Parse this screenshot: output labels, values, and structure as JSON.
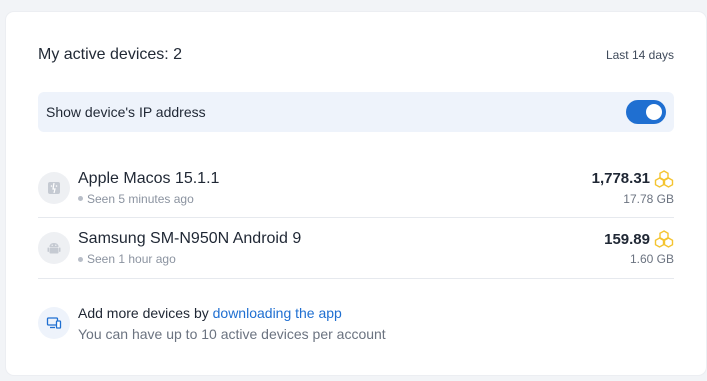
{
  "header": {
    "title": "My active devices: 2",
    "period": "Last 14 days"
  },
  "ip_setting": {
    "label": "Show device's IP address",
    "enabled": true
  },
  "devices": [
    {
      "icon": "apple-finder-icon",
      "name": "Apple Macos 15.1.1",
      "seen": "Seen 5 minutes ago",
      "points": "1,778.31",
      "traffic": "17.78 GB"
    },
    {
      "icon": "android-icon",
      "name": "Samsung SM-N950N Android 9",
      "seen": "Seen 1 hour ago",
      "points": "159.89",
      "traffic": "1.60 GB"
    }
  ],
  "footer": {
    "icon": "devices-icon",
    "text_prefix": "Add more devices by ",
    "link_text": "downloading the app",
    "subtext": "You can have up to 10 active devices per account"
  },
  "colors": {
    "accent": "#1f6fd1",
    "points_icon": "#f4c430"
  }
}
